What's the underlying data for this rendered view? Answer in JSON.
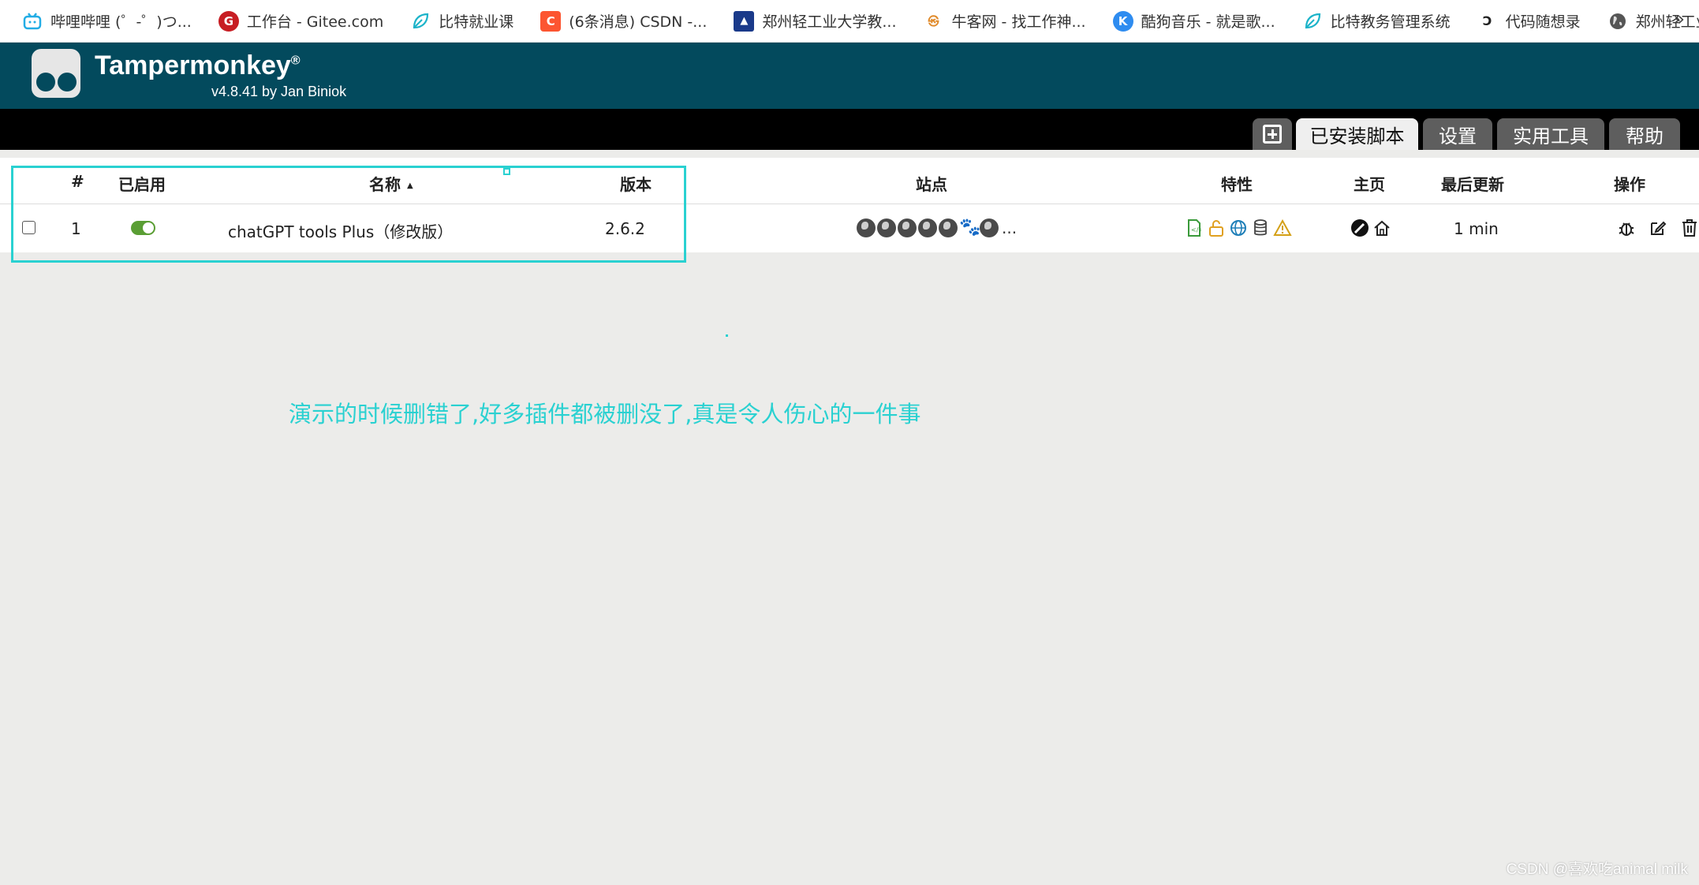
{
  "bookmarks": [
    {
      "label": "哔哩哔哩 (゜-゜)つ...",
      "icon": "bilibili-icon",
      "color": "#23ade5"
    },
    {
      "label": "工作台 - Gitee.com",
      "icon": "gitee-icon",
      "color": "#c71d23"
    },
    {
      "label": "比特就业课",
      "icon": "leaf-icon",
      "color": "#1bb3c9"
    },
    {
      "label": "(6条消息) CSDN -...",
      "icon": "csdn-icon",
      "color": "#fc5531"
    },
    {
      "label": "郑州轻工业大学教...",
      "icon": "university-icon",
      "color": "#1a3a8a"
    },
    {
      "label": "牛客网 - 找工作神...",
      "icon": "nowcoder-icon",
      "color": "#e08a2a"
    },
    {
      "label": "酷狗音乐 - 就是歌...",
      "icon": "kugou-icon",
      "color": "#2e8cf0"
    },
    {
      "label": "比特教务管理系统",
      "icon": "leaf-icon",
      "color": "#1bb3c9"
    },
    {
      "label": "代码随想录",
      "icon": "code-icon",
      "color": "#222222"
    },
    {
      "label": "郑州轻工业大学",
      "icon": "globe-icon",
      "color": "#555555"
    }
  ],
  "bookmarks_more": "»",
  "header": {
    "title": "Tampermonkey",
    "trademark": "®",
    "subtitle": "v4.8.41 by Jan Biniok"
  },
  "tabs": {
    "installed": "已安装脚本",
    "settings": "设置",
    "utilities": "实用工具",
    "help": "帮助"
  },
  "table": {
    "columns": {
      "index": "#",
      "enabled": "已启用",
      "name": "名称",
      "version": "版本",
      "sites": "站点",
      "features": "特性",
      "homepage": "主页",
      "last_updated": "最后更新",
      "actions": "操作"
    },
    "sort_indicator": "▲",
    "rows": [
      {
        "index": "1",
        "enabled": true,
        "name": "chatGPT tools Plus（修改版）",
        "version": "2.6.2",
        "sites_more": "...",
        "last_updated": "1 min"
      }
    ]
  },
  "annotation": {
    "text": "演示的时候删错了,好多插件都被删没了,真是令人伤心的一件事",
    "color": "#2ad1d1"
  },
  "watermark": "CSDN @喜欢吃animal milk",
  "colors": {
    "header_bg": "#034a5d",
    "toggle_on": "#5a9e34",
    "page_bg": "#ececea"
  }
}
